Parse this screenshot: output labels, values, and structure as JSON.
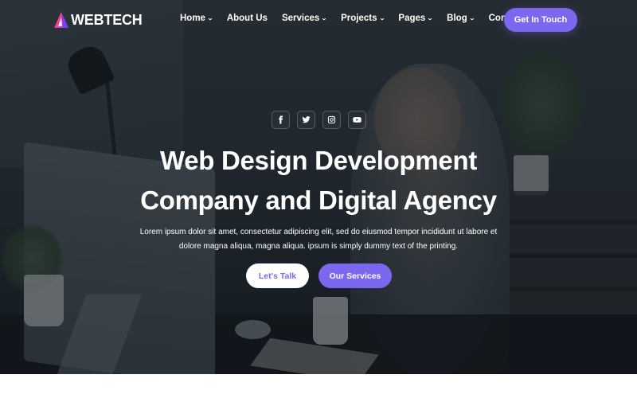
{
  "brand": {
    "name": "WEBTECH",
    "logo_icon": "triangle-logo-icon",
    "accent_color": "#7b68ee"
  },
  "nav": {
    "items": [
      {
        "label": "Home",
        "has_dropdown": true
      },
      {
        "label": "About Us",
        "has_dropdown": false
      },
      {
        "label": "Services",
        "has_dropdown": true
      },
      {
        "label": "Projects",
        "has_dropdown": true
      },
      {
        "label": "Pages",
        "has_dropdown": true
      },
      {
        "label": "Blog",
        "has_dropdown": true
      },
      {
        "label": "Contact",
        "has_dropdown": false
      }
    ],
    "dropdown_icon": "chevron-down-icon",
    "cta_label": "Get In Touch"
  },
  "social": [
    {
      "name": "facebook",
      "icon": "facebook-icon"
    },
    {
      "name": "twitter",
      "icon": "twitter-icon"
    },
    {
      "name": "instagram",
      "icon": "instagram-icon"
    },
    {
      "name": "youtube",
      "icon": "youtube-icon"
    }
  ],
  "hero": {
    "title_line1": "Web Design Development",
    "title_line2": "Company and Digital Agency",
    "description_line1": "Lorem ipsum dolor sit amet, consectetur adipiscing elit, sed do eiusmod tempor incididunt ut labore et",
    "description_line2": "dolore magna aliqua, magna aliqua. ipsum is simply dummy text of the printing.",
    "primary_button": "Our Services",
    "secondary_button": "Let's Talk"
  }
}
